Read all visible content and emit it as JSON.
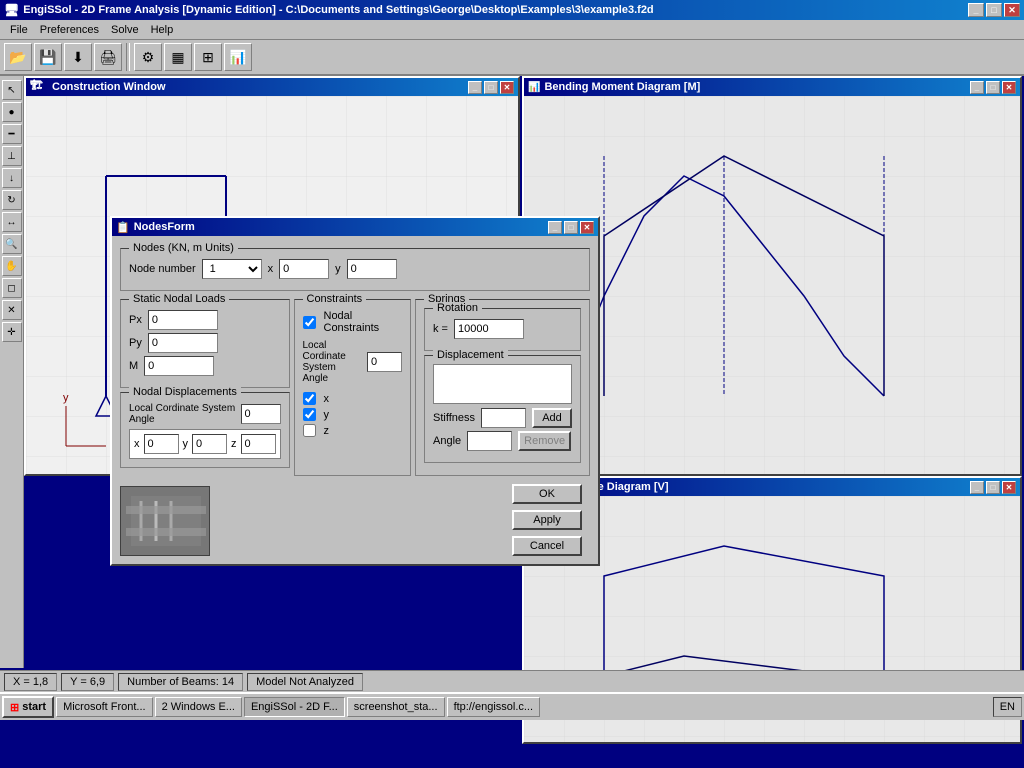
{
  "app": {
    "title": "EngiSSol - 2D Frame Analysis [Dynamic Edition] - C:\\Documents and Settings\\George\\Desktop\\Examples\\3\\example3.f2d",
    "icon": "E"
  },
  "titlebar_buttons": {
    "minimize": "_",
    "maximize": "□",
    "close": "✕"
  },
  "menubar": {
    "items": [
      "File",
      "Preferences",
      "Solve",
      "Help"
    ]
  },
  "toolbar": {
    "buttons": [
      "📂",
      "💾",
      "⬇",
      "🖨",
      "⚙",
      "▦",
      "⊞",
      "📊"
    ]
  },
  "windows": {
    "construction": {
      "title": "Construction Window",
      "icon": "C"
    },
    "bending": {
      "title": "Bending Moment Diagram [M]",
      "icon": "B"
    },
    "axial": {
      "title": "Axial Force Diagram [V]",
      "icon": "A"
    }
  },
  "nodes_form": {
    "title": "NodesForm",
    "nodes_group_label": "Nodes (KN, m Units)",
    "node_number_label": "Node number",
    "node_number_value": "1",
    "x_label": "x",
    "x_value": "0",
    "y_label": "y",
    "y_value": "0",
    "static_nodal_group": "Static Nodal Loads",
    "px_label": "Px",
    "px_value": "0",
    "py_label": "Py",
    "py_value": "0",
    "m_label": "M",
    "m_value": "0",
    "constraints_group": "Constraints",
    "nodal_constraints_label": "Nodal Constraints",
    "nodal_constraints_checked": true,
    "local_coord_label": "Local Cordinate System Angle",
    "local_coord_value": "0",
    "x_check_label": "x",
    "x_checked": true,
    "y_check_label": "y",
    "y_checked": true,
    "z_check_label": "z",
    "z_checked": false,
    "springs_group": "Springs",
    "rotation_group": "Rotation",
    "k_label": "k =",
    "k_value": "10000",
    "displacement_group": "Displacement",
    "stiffness_label": "Stiffness",
    "stiffness_value": "",
    "add_label": "Add",
    "angle_label": "Angle",
    "angle_value": "",
    "remove_label": "Remove",
    "nodal_disp_group": "Nodal Displacements",
    "local_coord_angle_label": "Local Cordinate System Angle",
    "local_coord_angle_value": "0",
    "x_disp_label": "x",
    "x_disp_value": "0",
    "y_disp_label": "y",
    "y_disp_value": "0",
    "z_disp_label": "z",
    "z_disp_value": "0",
    "ok_label": "OK",
    "apply_label": "Apply",
    "cancel_label": "Cancel"
  },
  "statusbar": {
    "coord_x": "X = 1,8",
    "coord_y": "Y = 6,9",
    "beams": "Number of Beams: 14",
    "analysis": "Model Not Analyzed"
  },
  "taskbar": {
    "start_label": "start",
    "items": [
      {
        "label": "Microsoft Front...",
        "icon": "M"
      },
      {
        "label": "2 Windows E...",
        "icon": "W"
      },
      {
        "label": "EngiSSol - 2D F...",
        "icon": "E",
        "active": true
      },
      {
        "label": "screenshot_sta...",
        "icon": "S"
      },
      {
        "label": "ftp://engissol.c...",
        "icon": "F"
      }
    ],
    "language": "EN",
    "time": ""
  }
}
